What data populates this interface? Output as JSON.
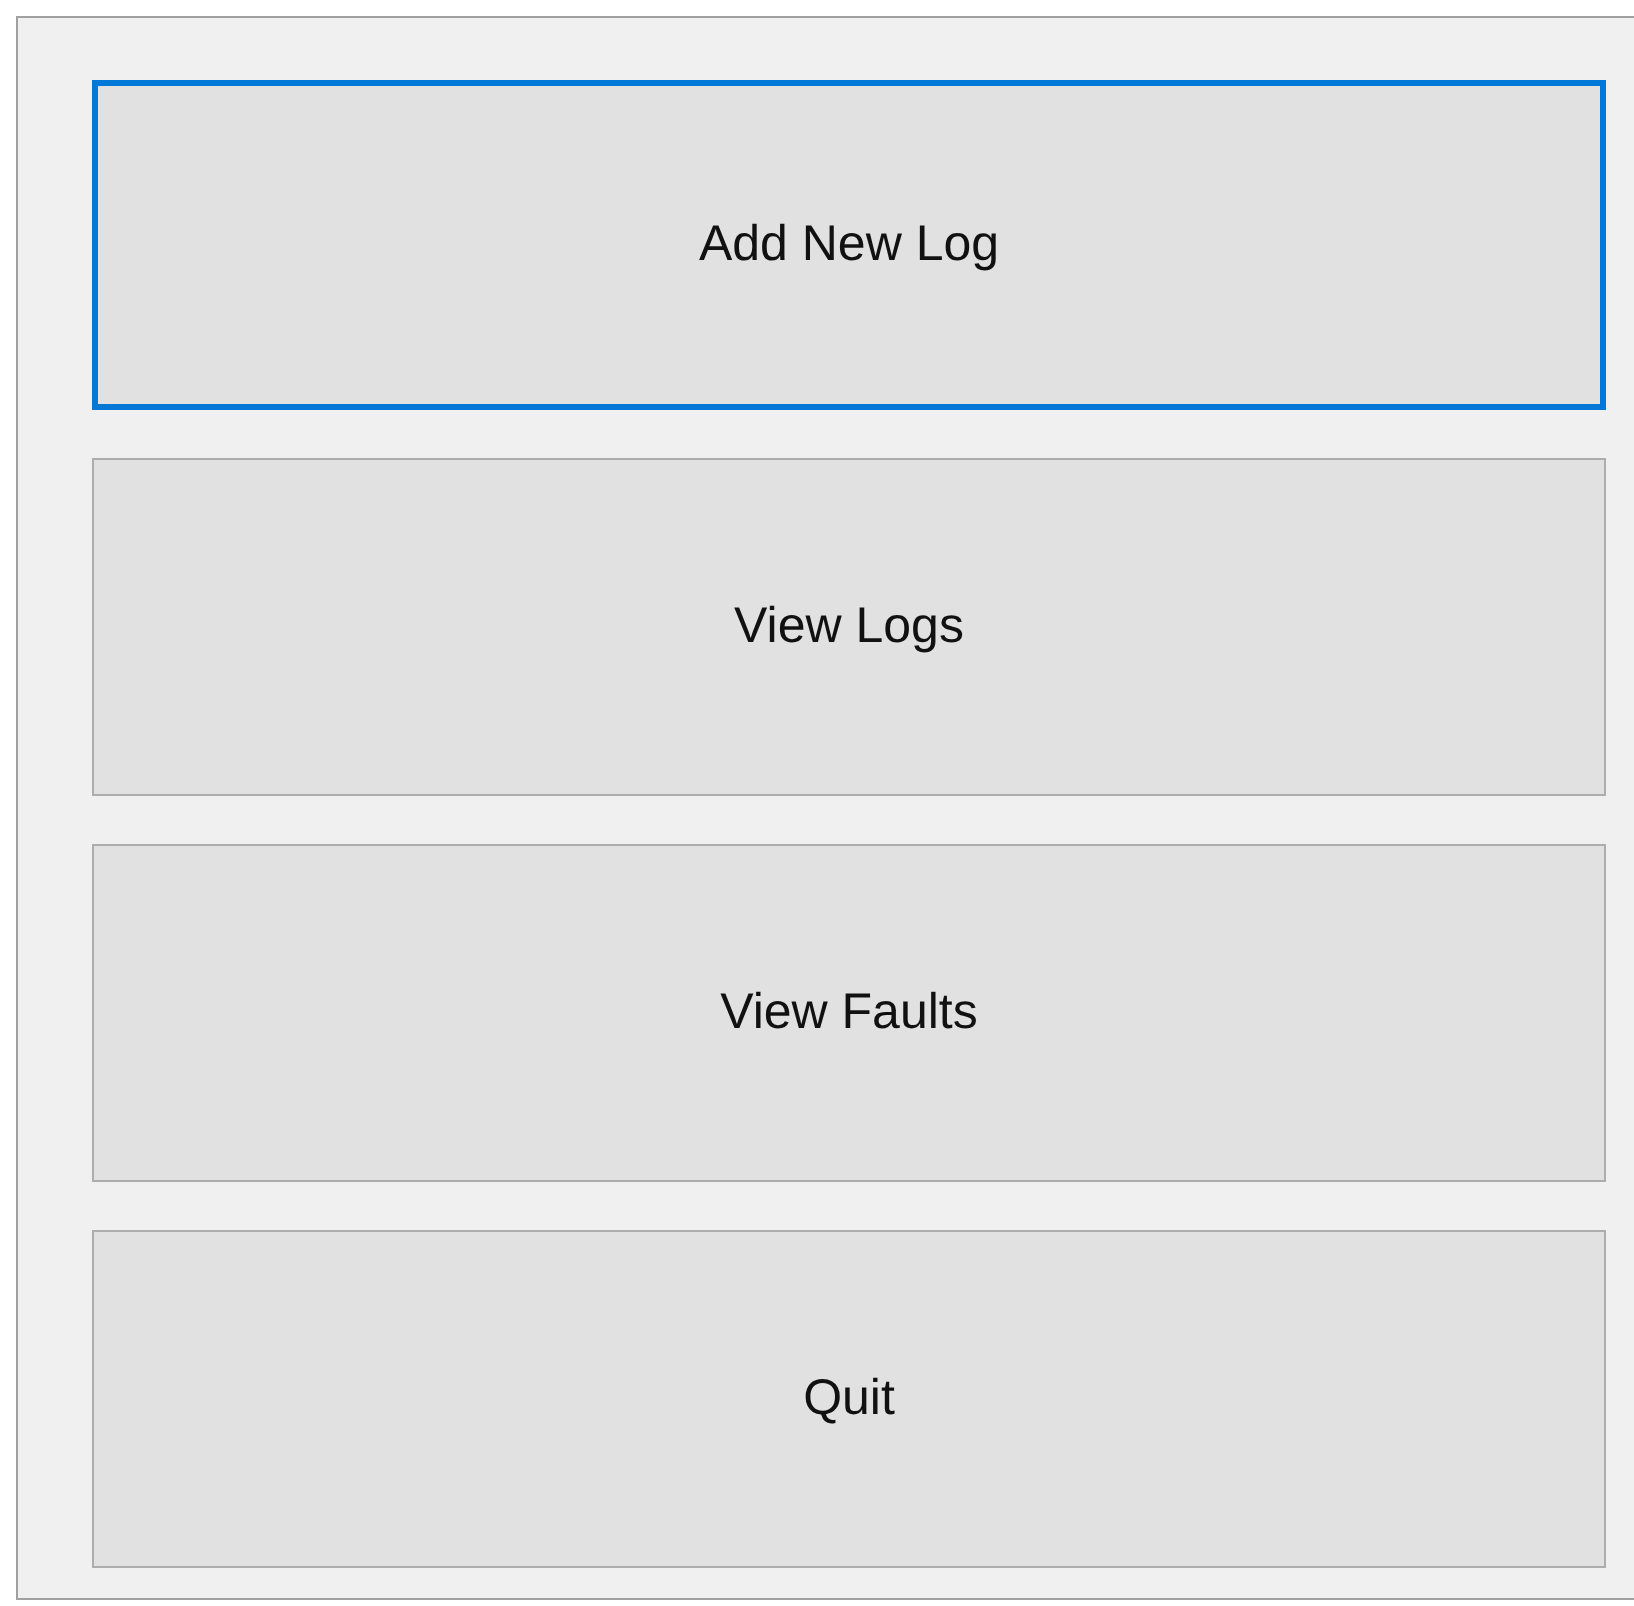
{
  "buttons": [
    {
      "label": "Add New Log",
      "focused": true
    },
    {
      "label": "View Logs",
      "focused": false
    },
    {
      "label": "View Faults",
      "focused": false
    },
    {
      "label": "Quit",
      "focused": false
    }
  ]
}
